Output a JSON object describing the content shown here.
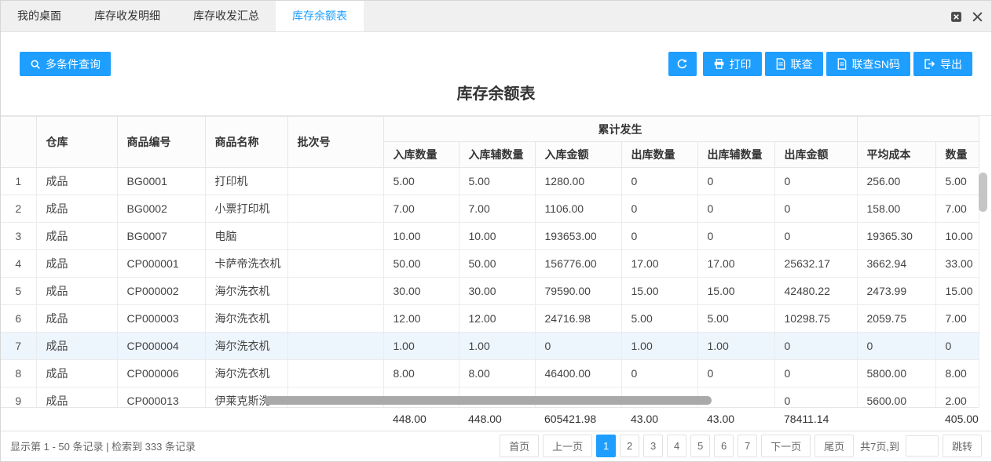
{
  "tabs": [
    {
      "id": "tab-my-desktop",
      "label": "我的桌面",
      "active": false
    },
    {
      "id": "tab-stock-inout-detail",
      "label": "库存收发明细",
      "active": false
    },
    {
      "id": "tab-stock-inout-summary",
      "label": "库存收发汇总",
      "active": false
    },
    {
      "id": "tab-stock-balance",
      "label": "库存余额表",
      "active": true
    }
  ],
  "toolbar": {
    "multi_query": "多条件查询",
    "print": "打印",
    "linked_query": "联查",
    "linked_query_sn": "联查SN码",
    "export": "导出"
  },
  "page_title": "库存余额表",
  "table": {
    "group_header": "累计发生",
    "columns": [
      "仓库",
      "商品编号",
      "商品名称",
      "批次号"
    ],
    "sub_columns": [
      "入库数量",
      "入库辅数量",
      "入库金额",
      "出库数量",
      "出库辅数量",
      "出库金额",
      "平均成本",
      "数量"
    ],
    "rows": [
      {
        "index": "1",
        "warehouse": "成品",
        "code": "BG0001",
        "name": "打印机",
        "batch": "",
        "in_qty": "5.00",
        "in_aux_qty": "5.00",
        "in_amount": "1280.00",
        "out_qty": "0",
        "out_aux_qty": "0",
        "out_amount": "0",
        "avg_cost": "256.00",
        "qty": "5.00",
        "highlighted": false
      },
      {
        "index": "2",
        "warehouse": "成品",
        "code": "BG0002",
        "name": "小票打印机",
        "batch": "",
        "in_qty": "7.00",
        "in_aux_qty": "7.00",
        "in_amount": "1106.00",
        "out_qty": "0",
        "out_aux_qty": "0",
        "out_amount": "0",
        "avg_cost": "158.00",
        "qty": "7.00",
        "highlighted": false
      },
      {
        "index": "3",
        "warehouse": "成品",
        "code": "BG0007",
        "name": "电脑",
        "batch": "",
        "in_qty": "10.00",
        "in_aux_qty": "10.00",
        "in_amount": "193653.00",
        "out_qty": "0",
        "out_aux_qty": "0",
        "out_amount": "0",
        "avg_cost": "19365.30",
        "qty": "10.00",
        "highlighted": false
      },
      {
        "index": "4",
        "warehouse": "成品",
        "code": "CP000001",
        "name": "卡萨帝洗衣机",
        "batch": "",
        "in_qty": "50.00",
        "in_aux_qty": "50.00",
        "in_amount": "156776.00",
        "out_qty": "17.00",
        "out_aux_qty": "17.00",
        "out_amount": "25632.17",
        "avg_cost": "3662.94",
        "qty": "33.00",
        "highlighted": false
      },
      {
        "index": "5",
        "warehouse": "成品",
        "code": "CP000002",
        "name": "海尔洗衣机",
        "batch": "",
        "in_qty": "30.00",
        "in_aux_qty": "30.00",
        "in_amount": "79590.00",
        "out_qty": "15.00",
        "out_aux_qty": "15.00",
        "out_amount": "42480.22",
        "avg_cost": "2473.99",
        "qty": "15.00",
        "highlighted": false
      },
      {
        "index": "6",
        "warehouse": "成品",
        "code": "CP000003",
        "name": "海尔洗衣机",
        "batch": "",
        "in_qty": "12.00",
        "in_aux_qty": "12.00",
        "in_amount": "24716.98",
        "out_qty": "5.00",
        "out_aux_qty": "5.00",
        "out_amount": "10298.75",
        "avg_cost": "2059.75",
        "qty": "7.00",
        "highlighted": false
      },
      {
        "index": "7",
        "warehouse": "成品",
        "code": "CP000004",
        "name": "海尔洗衣机",
        "batch": "",
        "in_qty": "1.00",
        "in_aux_qty": "1.00",
        "in_amount": "0",
        "out_qty": "1.00",
        "out_aux_qty": "1.00",
        "out_amount": "0",
        "avg_cost": "0",
        "qty": "0",
        "highlighted": true
      },
      {
        "index": "8",
        "warehouse": "成品",
        "code": "CP000006",
        "name": "海尔洗衣机",
        "batch": "",
        "in_qty": "8.00",
        "in_aux_qty": "8.00",
        "in_amount": "46400.00",
        "out_qty": "0",
        "out_aux_qty": "0",
        "out_amount": "0",
        "avg_cost": "5800.00",
        "qty": "8.00",
        "highlighted": false
      },
      {
        "index": "9",
        "warehouse": "成品",
        "code": "CP000013",
        "name": "伊莱克斯洗",
        "batch": "",
        "in_qty": "",
        "in_aux_qty": "",
        "in_amount": "",
        "out_qty": "",
        "out_aux_qty": "",
        "out_amount": "0",
        "avg_cost": "5600.00",
        "qty": "2.00",
        "highlighted": false
      }
    ],
    "summary": {
      "in_qty": "448.00",
      "in_aux_qty": "448.00",
      "in_amount": "605421.98",
      "out_qty": "43.00",
      "out_aux_qty": "43.00",
      "out_amount": "78411.14",
      "avg_cost": "",
      "qty": "405.00"
    }
  },
  "footer": {
    "record_info": "显示第 1 - 50 条记录 | 检索到 333 条记录",
    "pagination": {
      "first": "首页",
      "prev": "上一页",
      "pages": [
        "1",
        "2",
        "3",
        "4",
        "5",
        "6",
        "7"
      ],
      "active_page": "1",
      "next": "下一页",
      "last": "尾页",
      "total_label": "共7页,到",
      "jump_label": "跳转",
      "jump_value": ""
    }
  },
  "colors": {
    "accent": "#1E9FFF"
  }
}
